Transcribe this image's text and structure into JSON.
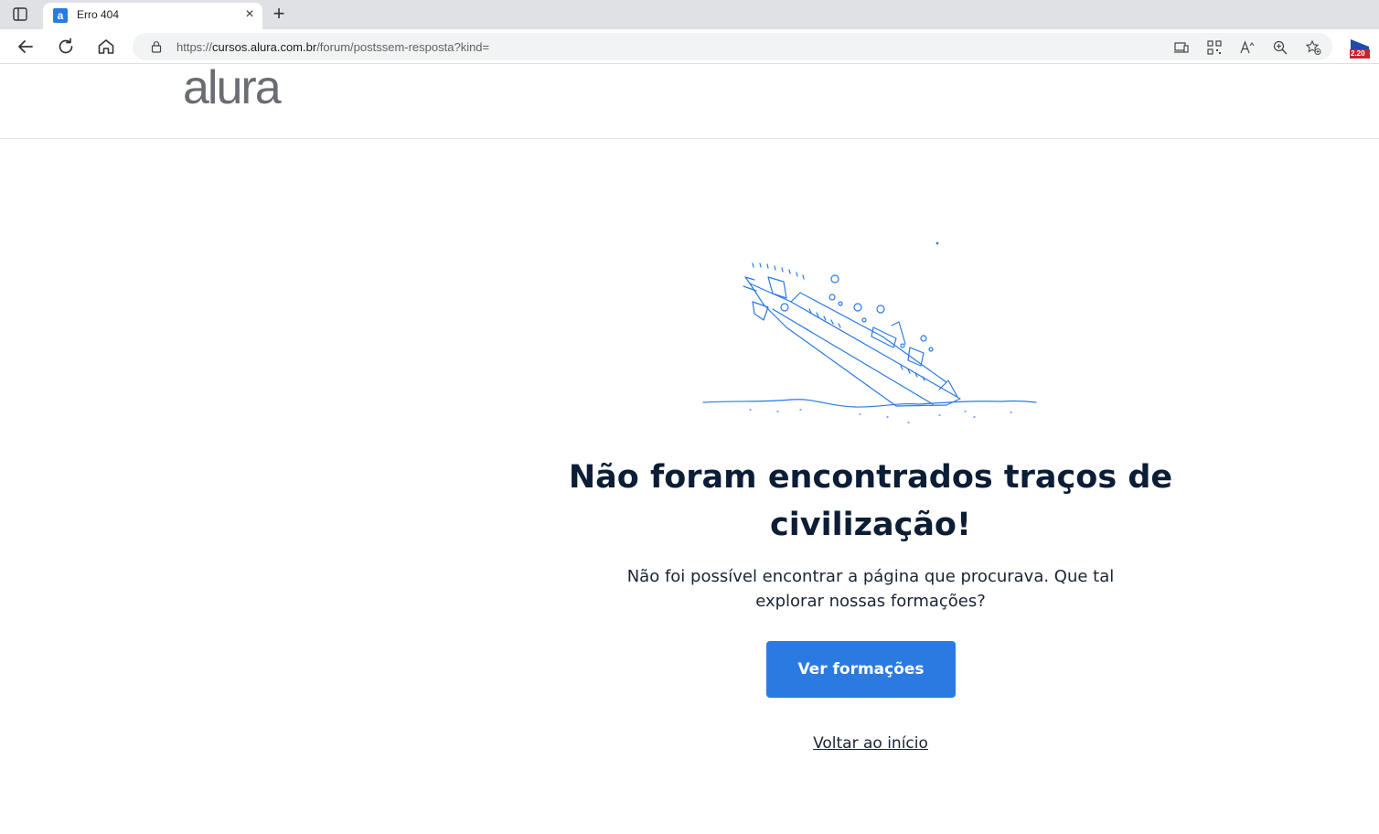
{
  "browser": {
    "tab_title": "Erro 404",
    "favicon_letter": "a",
    "url_prefix": "https://",
    "url_host": "cursos.alura.com.br",
    "url_path": "/forum/postssem-resposta?kind=",
    "extension_badge": "2.20"
  },
  "site": {
    "logo": "alura"
  },
  "error": {
    "title": "Não foram encontrados traços de civilização!",
    "description": "Não foi possível encontrar a página que procurava. Que tal explorar nossas formações?",
    "cta_label": "Ver formações",
    "back_label": "Voltar ao início"
  },
  "colors": {
    "brand_blue": "#2a7ae2",
    "title_text": "#0c1d36",
    "logo_gray": "#6a6e73"
  },
  "icons": [
    "tab-actions-icon",
    "close-icon",
    "plus-icon",
    "back-arrow-icon",
    "refresh-icon",
    "home-icon",
    "lock-icon",
    "device-icon",
    "qr-icon",
    "read-aloud-icon",
    "zoom-icon",
    "favorites-icon",
    "extension-icon",
    "sinking-ship-illustration"
  ]
}
